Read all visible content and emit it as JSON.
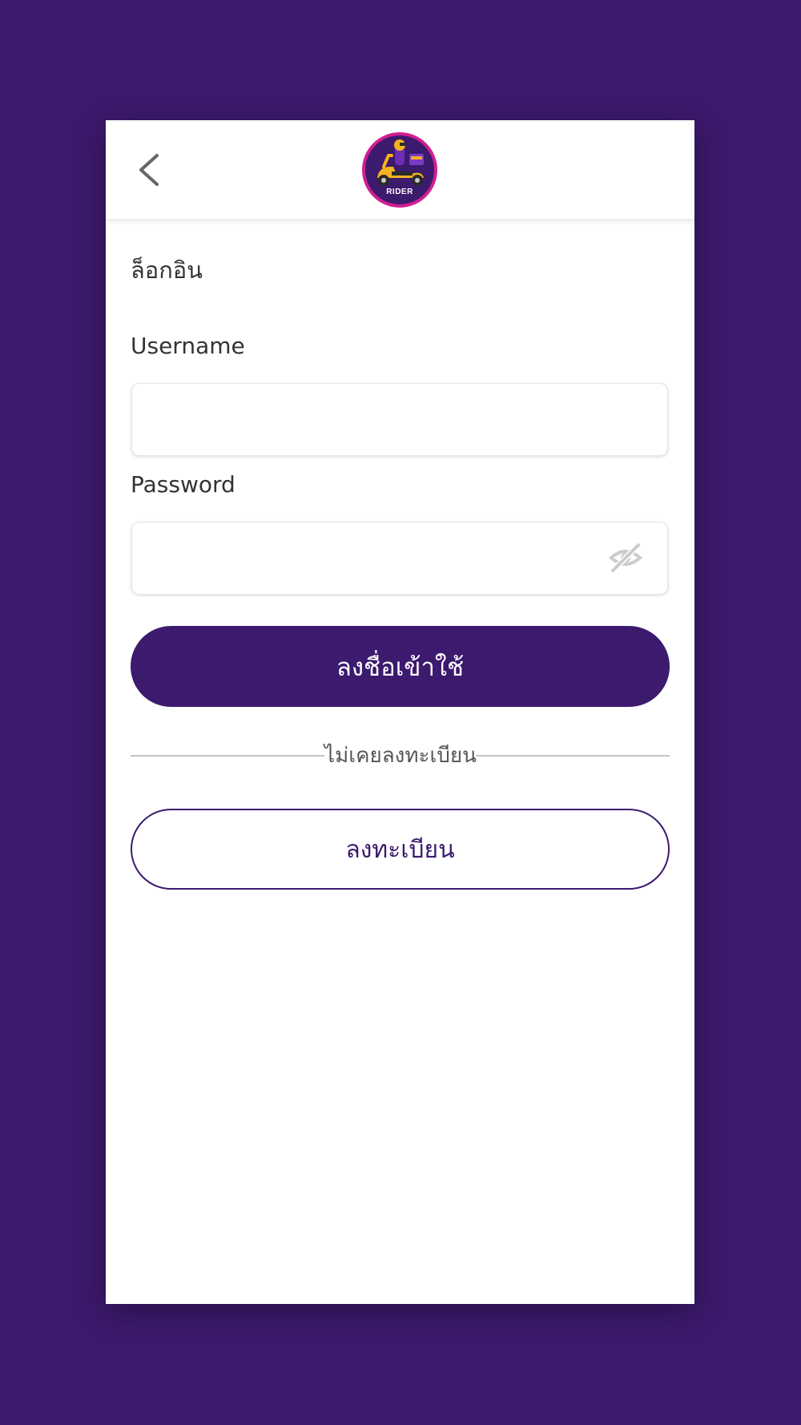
{
  "header": {
    "back_icon": "chevron-left-icon",
    "logo_text": "RIDER"
  },
  "login": {
    "title": "ล็อกอิน",
    "username_label": "Username",
    "username_value": "",
    "username_placeholder": "",
    "password_label": "Password",
    "password_value": "",
    "password_placeholder": "",
    "password_toggle_icon": "eye-off-icon",
    "submit_label": "ลงชื่อเข้าใช้"
  },
  "register": {
    "divider_text": "ไม่เคยลงทะเบียน",
    "button_label": "ลงทะเบียน"
  },
  "colors": {
    "brand": "#3c1a6e",
    "background": "#3c1a6e",
    "surface": "#ffffff",
    "logo_ring": "#d11f8f",
    "logo_scooter": "#f5b21e"
  }
}
